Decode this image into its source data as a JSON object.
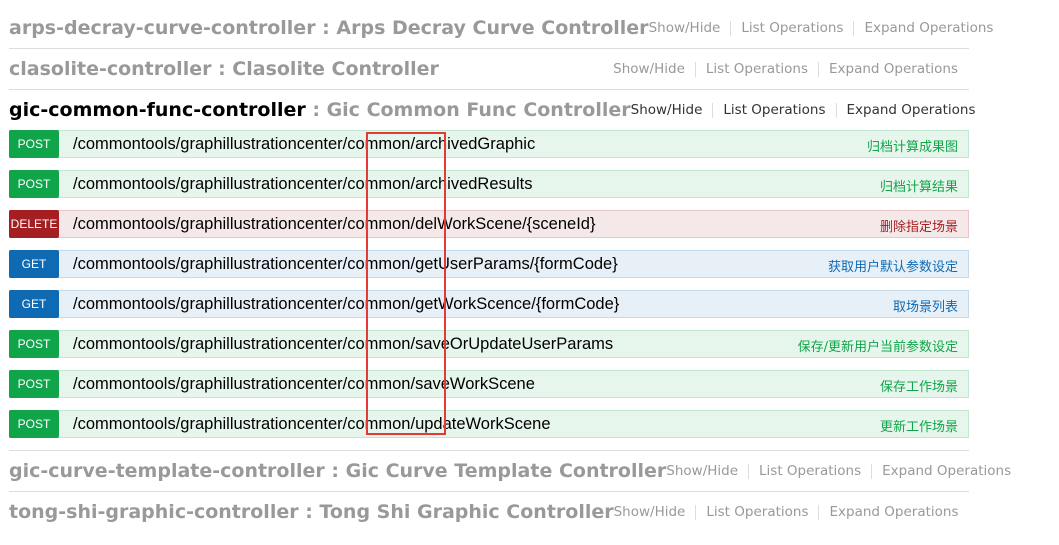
{
  "resources": [
    {
      "name": "arps-decray-curve-controller",
      "sep": " : ",
      "desc": "Arps Decray Curve Controller",
      "show_hide": "Show/Hide",
      "list_ops": "List Operations",
      "expand_ops": "Expand Operations"
    },
    {
      "name": "clasolite-controller",
      "sep": " : ",
      "desc": "Clasolite Controller",
      "show_hide": "Show/Hide",
      "list_ops": "List Operations",
      "expand_ops": "Expand Operations"
    },
    {
      "name": "gic-common-func-controller",
      "sep": " : ",
      "desc": "Gic Common Func Controller",
      "show_hide": "Show/Hide",
      "list_ops": "List Operations",
      "expand_ops": "Expand Operations",
      "operations": [
        {
          "method": "POST",
          "path": "/commontools/graphillustrationcenter/common/archivedGraphic",
          "summary": "归档计算成果图"
        },
        {
          "method": "POST",
          "path": "/commontools/graphillustrationcenter/common/archivedResults",
          "summary": "归档计算结果"
        },
        {
          "method": "DELETE",
          "path": "/commontools/graphillustrationcenter/common/delWorkScene/{sceneId}",
          "summary": "删除指定场景"
        },
        {
          "method": "GET",
          "path": "/commontools/graphillustrationcenter/common/getUserParams/{formCode}",
          "summary": "获取用户默认参数设定"
        },
        {
          "method": "GET",
          "path": "/commontools/graphillustrationcenter/common/getWorkScence/{formCode}",
          "summary": "取场景列表"
        },
        {
          "method": "POST",
          "path": "/commontools/graphillustrationcenter/common/saveOrUpdateUserParams",
          "summary": "保存/更新用户当前参数设定"
        },
        {
          "method": "POST",
          "path": "/commontools/graphillustrationcenter/common/saveWorkScene",
          "summary": "保存工作场景"
        },
        {
          "method": "POST",
          "path": "/commontools/graphillustrationcenter/common/updateWorkScene",
          "summary": "更新工作场景"
        }
      ]
    },
    {
      "name": "gic-curve-template-controller",
      "sep": " : ",
      "desc": "Gic Curve Template Controller",
      "show_hide": "Show/Hide",
      "list_ops": "List Operations",
      "expand_ops": "Expand Operations"
    },
    {
      "name": "tong-shi-graphic-controller",
      "sep": " : ",
      "desc": "Tong Shi Graphic Controller",
      "show_hide": "Show/Hide",
      "list_ops": "List Operations",
      "expand_ops": "Expand Operations"
    }
  ],
  "colors": {
    "post": "#10a54a",
    "delete": "#a41e22",
    "get": "#0f6ab4",
    "highlight": "#e53935"
  }
}
